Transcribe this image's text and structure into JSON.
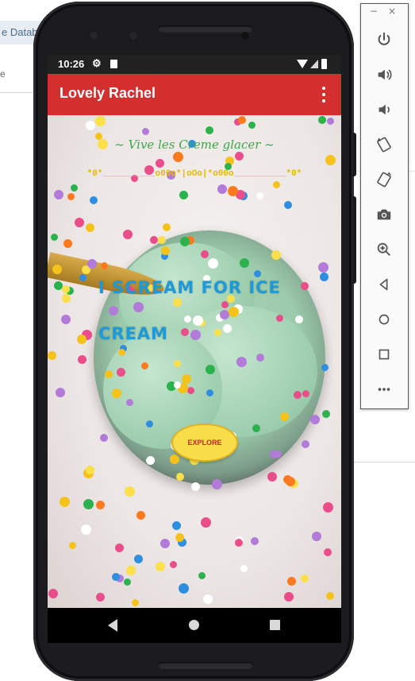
{
  "ide": {
    "tab_label": "e Datab"
  },
  "device": {
    "status_bar": {
      "time": "10:26"
    },
    "app_bar": {
      "title": "Lovely Rachel"
    },
    "content": {
      "tagline": "~ Vive les Creme glacer ~",
      "divider": "*0*__________o00o*|oOo|*o00o__________*0*",
      "headline_line1": "I SCREAM FOR ICE",
      "headline_line2": "CREAM",
      "explore_label": "EXPLORE"
    }
  },
  "emulator_toolbar": {
    "minimize": "−",
    "close": "×",
    "tools": [
      "power-icon",
      "volume-up-icon",
      "volume-down-icon",
      "rotate-left-icon",
      "rotate-right-icon",
      "camera-icon",
      "zoom-icon",
      "back-icon",
      "home-icon",
      "overview-icon",
      "more-icon"
    ]
  },
  "colors": {
    "app_bar": "#d32f2f",
    "status_bar": "#212121",
    "tagline": "#3ea64b",
    "divider": "#e6b800",
    "headline": "#1e9ad8",
    "explore_button": "#f7dd4a",
    "explore_text": "#c62828"
  }
}
